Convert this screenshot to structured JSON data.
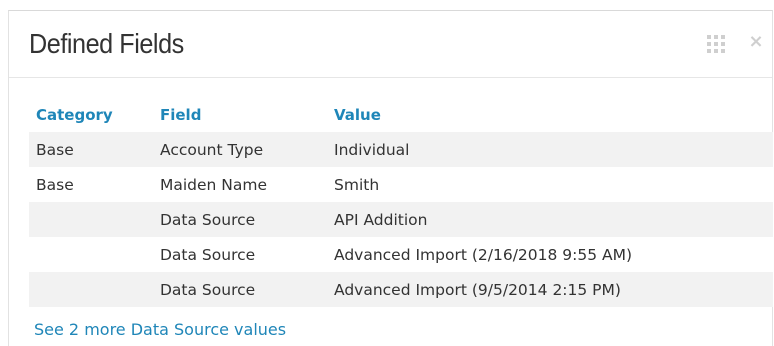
{
  "panel": {
    "title": "Defined Fields",
    "grid_icon": "grid-icon",
    "close_icon": "close-icon",
    "close_glyph": "×"
  },
  "table": {
    "headers": {
      "category": "Category",
      "field": "Field",
      "value": "Value"
    },
    "rows": [
      {
        "category": "Base",
        "field": "Account Type",
        "value": "Individual"
      },
      {
        "category": "Base",
        "field": "Maiden Name",
        "value": "Smith"
      },
      {
        "category": "",
        "field": "Data Source",
        "value": "API Addition"
      },
      {
        "category": "",
        "field": "Data Source",
        "value": "Advanced Import (2/16/2018 9:55 AM)"
      },
      {
        "category": "",
        "field": "Data Source",
        "value": "Advanced Import (9/5/2014 2:15 PM)"
      }
    ]
  },
  "more_link": "See 2 more Data Source values",
  "colors": {
    "accent": "#1f86b8",
    "row_shade": "#f2f2f2",
    "text": "#333333"
  }
}
